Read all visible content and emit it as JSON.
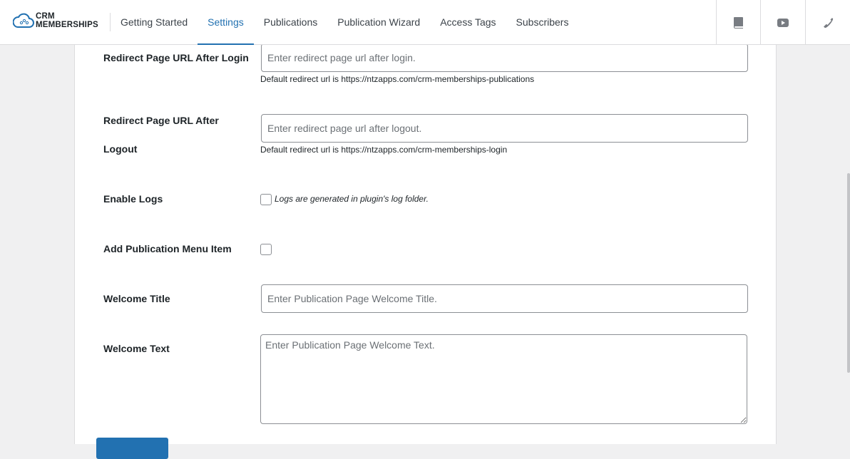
{
  "header": {
    "logo_line1": "CRM",
    "logo_line2": "MEMBERSHIPS",
    "nav": [
      {
        "label": "Getting Started",
        "active": false
      },
      {
        "label": "Settings",
        "active": true
      },
      {
        "label": "Publications",
        "active": false
      },
      {
        "label": "Publication Wizard",
        "active": false
      },
      {
        "label": "Access Tags",
        "active": false
      },
      {
        "label": "Subscribers",
        "active": false
      }
    ],
    "tools": [
      {
        "icon": "book-icon"
      },
      {
        "icon": "youtube-icon"
      },
      {
        "icon": "phone-icon"
      }
    ]
  },
  "form": {
    "redirect_login": {
      "label": "Redirect Page URL After Login",
      "placeholder": "Enter redirect page url after login.",
      "value": "",
      "description": "Default redirect url is https://ntzapps.com/crm-memberships-publications"
    },
    "redirect_logout": {
      "label_line1": "Redirect Page URL After",
      "label_line2": "Logout",
      "placeholder": "Enter redirect page url after logout.",
      "value": "",
      "description": "Default redirect url is https://ntzapps.com/crm-memberships-login"
    },
    "enable_logs": {
      "label": "Enable Logs",
      "checked": false,
      "note": "Logs are generated in plugin's log folder."
    },
    "add_menu_item": {
      "label": "Add Publication Menu Item",
      "checked": false
    },
    "welcome_title": {
      "label": "Welcome Title",
      "placeholder": "Enter Publication Page Welcome Title.",
      "value": ""
    },
    "welcome_text": {
      "label": "Welcome Text",
      "placeholder": "Enter Publication Page Welcome Text.",
      "value": ""
    },
    "submit_label": ""
  },
  "colors": {
    "accent": "#2271b1",
    "background": "#f0f0f1",
    "panel": "#ffffff"
  }
}
